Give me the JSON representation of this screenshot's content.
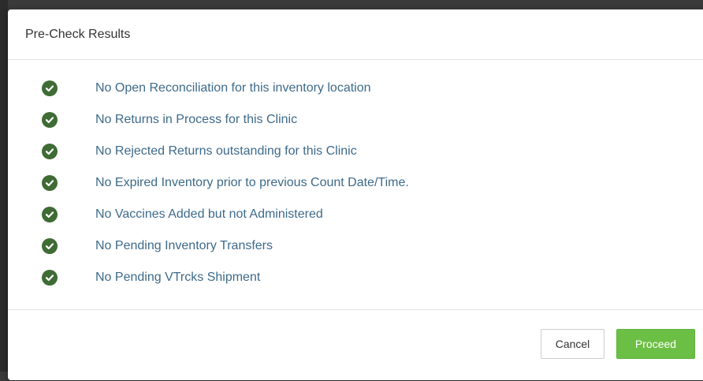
{
  "modal": {
    "title": "Pre-Check Results",
    "items": [
      {
        "label": "No Open Reconciliation for this inventory location",
        "status": "passed"
      },
      {
        "label": "No Returns in Process for this Clinic",
        "status": "passed"
      },
      {
        "label": "No Rejected Returns outstanding for this Clinic",
        "status": "passed"
      },
      {
        "label": "No Expired Inventory prior to previous Count Date/Time.",
        "status": "passed"
      },
      {
        "label": "No Vaccines Added but not Administered",
        "status": "passed"
      },
      {
        "label": "No Pending Inventory Transfers",
        "status": "passed"
      },
      {
        "label": "No Pending VTrcks Shipment",
        "status": "passed"
      }
    ],
    "cancel_label": "Cancel",
    "proceed_label": "Proceed"
  },
  "colors": {
    "check_icon": "#3f6b35",
    "item_text": "#3d6a8a",
    "proceed_button": "#6cbf45"
  },
  "icons": {
    "check": "check-circle-icon"
  }
}
